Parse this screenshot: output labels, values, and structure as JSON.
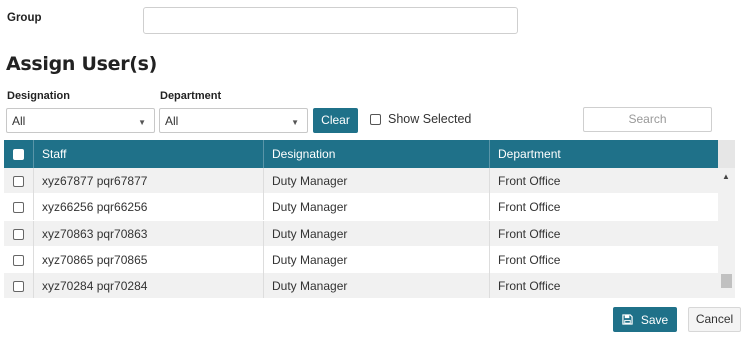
{
  "group": {
    "label": "Group",
    "value": ""
  },
  "section_title": "Assign User(s)",
  "filters": {
    "designation_label": "Designation",
    "designation_value": "All",
    "department_label": "Department",
    "department_value": "All",
    "clear_label": "Clear",
    "show_selected_label": "Show Selected",
    "search_placeholder": "Search"
  },
  "table": {
    "columns": [
      "Staff",
      "Designation",
      "Department"
    ],
    "rows": [
      [
        "xyz67877 pqr67877",
        "Duty Manager",
        "Front Office"
      ],
      [
        "xyz66256 pqr66256",
        "Duty Manager",
        "Front Office"
      ],
      [
        "xyz70863 pqr70863",
        "Duty Manager",
        "Front Office"
      ],
      [
        "xyz70865 pqr70865",
        "Duty Manager",
        "Front Office"
      ],
      [
        "xyz70284 pqr70284",
        "Duty Manager",
        "Front Office"
      ]
    ]
  },
  "actions": {
    "save_label": "Save",
    "cancel_label": "Cancel"
  },
  "colors": {
    "accent": "#1f7189"
  }
}
